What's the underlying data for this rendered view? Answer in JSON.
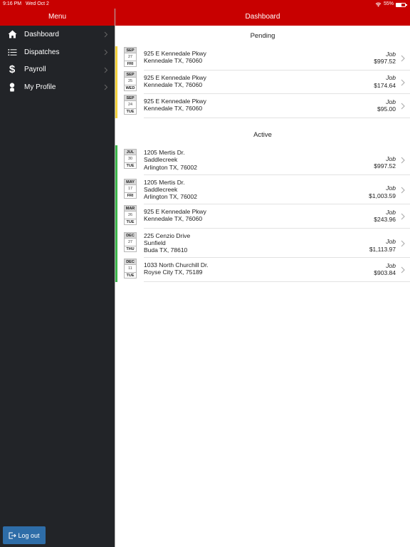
{
  "status_bar": {
    "time": "9:16 PM",
    "date": "Wed Oct 2",
    "battery": "55%",
    "battery_level": 0.55
  },
  "sidebar": {
    "title": "Menu",
    "items": [
      {
        "label": "Dashboard",
        "icon": "home-icon"
      },
      {
        "label": "Dispatches",
        "icon": "list-icon"
      },
      {
        "label": "Payroll",
        "icon": "dollar-icon"
      },
      {
        "label": "My Profile",
        "icon": "user-icon"
      }
    ],
    "logout_label": "Log out"
  },
  "main": {
    "title": "Dashboard",
    "sections": [
      {
        "title": "Pending",
        "accent": "#f2d13c",
        "rows": [
          {
            "month": "SEP",
            "day": "27",
            "weekday": "FRI",
            "lines": [
              "925 E Kennedale Pkwy",
              "Kennedale TX, 76060"
            ],
            "type": "Job",
            "amount": "$997.52"
          },
          {
            "month": "SEP",
            "day": "25",
            "weekday": "WED",
            "lines": [
              "925 E Kennedale Pkwy",
              "Kennedale TX, 76060"
            ],
            "type": "Job",
            "amount": "$174.64"
          },
          {
            "month": "SEP",
            "day": "24",
            "weekday": "TUE",
            "lines": [
              "925 E Kennedale Pkwy",
              "Kennedale TX, 76060"
            ],
            "type": "Job",
            "amount": "$95.00"
          }
        ]
      },
      {
        "title": "Active",
        "accent": "#3bb54a",
        "rows": [
          {
            "month": "JUL",
            "day": "30",
            "weekday": "TUE",
            "lines": [
              "1205 Mertis Dr.",
              "Saddlecreek",
              "Arlington TX, 76002"
            ],
            "type": "Job",
            "amount": "$997.52"
          },
          {
            "month": "MAY",
            "day": "17",
            "weekday": "FRI",
            "lines": [
              "1205 Mertis Dr.",
              "Saddlecreek",
              "Arlington TX, 76002"
            ],
            "type": "Job",
            "amount": "$1,003.59"
          },
          {
            "month": "MAR",
            "day": "26",
            "weekday": "TUE",
            "lines": [
              "925 E Kennedale Pkwy",
              "Kennedale TX, 76060"
            ],
            "type": "Job",
            "amount": "$243.96"
          },
          {
            "month": "DEC",
            "day": "27",
            "weekday": "THU",
            "lines": [
              "225 Cenzio Drive",
              "Sunfield",
              "Buda TX, 78610"
            ],
            "type": "Job",
            "amount": "$1,113.97"
          },
          {
            "month": "DEC",
            "day": "11",
            "weekday": "TUE",
            "lines": [
              "1033 North Churchill Dr.",
              "Royse City TX, 75189"
            ],
            "type": "Job",
            "amount": "$903.84"
          }
        ]
      }
    ]
  }
}
